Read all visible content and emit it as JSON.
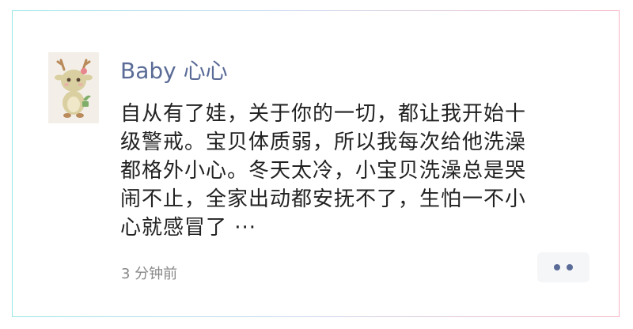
{
  "post": {
    "author": "Baby 心心",
    "lines": [
      "自从有了娃，关于你的一切，都让我开始十",
      "级警戒。宝贝体质弱，所以我每次给他洗澡",
      "都格外小心。冬天太冷，小宝贝洗澡总是哭",
      "闹不止，全家出动都安抚不了，生怕一不小",
      "心就感冒了 ···"
    ],
    "time": "3 分钟前"
  },
  "icons": {
    "avatar": "deer-avatar",
    "more": "more-dots-icon"
  },
  "colors": {
    "author_name": "#5a6b97",
    "body_text": "#222222",
    "meta_text": "#888888",
    "more_button_bg": "#f5f6f8"
  }
}
